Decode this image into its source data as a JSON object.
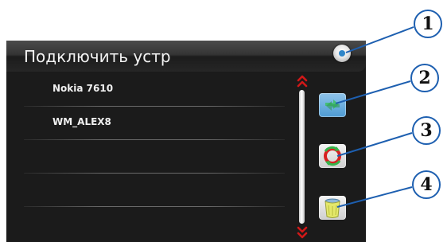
{
  "window": {
    "title": "Подключить устр"
  },
  "devices": [
    {
      "name": "Nokia 7610"
    },
    {
      "name": "WM_ALEX8"
    },
    {
      "name": ""
    },
    {
      "name": ""
    },
    {
      "name": ""
    }
  ],
  "toolbar": {
    "buttons": [
      {
        "icon": "power-icon"
      },
      {
        "icon": "connect-icon"
      },
      {
        "icon": "refresh-icon"
      },
      {
        "icon": "trash-icon"
      }
    ]
  },
  "callouts": [
    "1",
    "2",
    "3",
    "4"
  ],
  "colors": {
    "background": "#1b1b1b",
    "accent_blue": "#4e9bd3",
    "scroll_arrow_red": "#d01818",
    "callout_border": "#1d5fb0"
  }
}
